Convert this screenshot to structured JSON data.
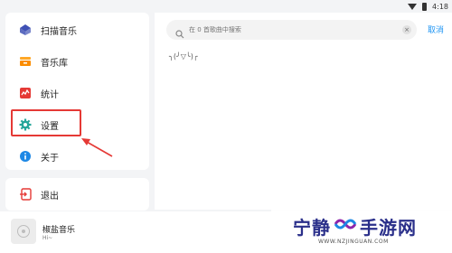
{
  "statusbar": {
    "time": "4:18"
  },
  "menu": {
    "items": [
      {
        "label": "扫描音乐",
        "icon": "scan-music-icon"
      },
      {
        "label": "音乐库",
        "icon": "library-icon"
      },
      {
        "label": "统计",
        "icon": "statistics-icon"
      },
      {
        "label": "设置",
        "icon": "gear-icon"
      },
      {
        "label": "关于",
        "icon": "info-icon"
      }
    ],
    "exit_label": "退出"
  },
  "search": {
    "placeholder": "在 0 首歌曲中搜索",
    "cancel_label": "取消",
    "empty_text": "╮(╯▽╰)╭"
  },
  "player": {
    "title": "椒盐音乐",
    "subtitle": "Hi~"
  },
  "watermark": {
    "left_text": "宁静",
    "right_text": "手游网",
    "url": "WWW.NZJINGUAN.COM"
  },
  "colors": {
    "accent": "#2196f3",
    "highlight": "#e53935",
    "watermark": "#2a2f8a"
  }
}
